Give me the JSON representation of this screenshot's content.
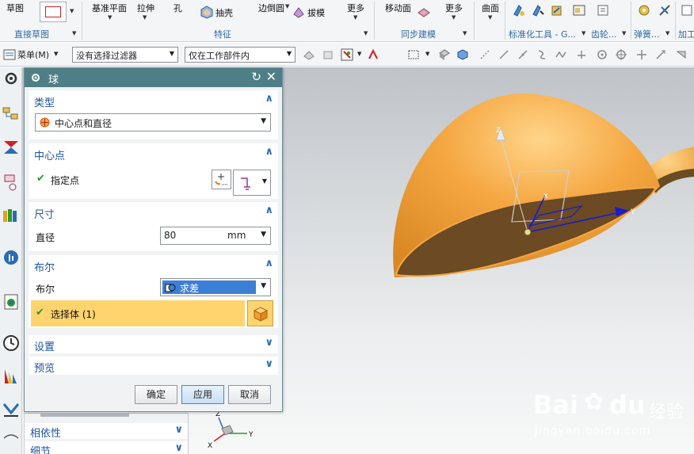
{
  "ribbon": {
    "sketch_label": "草图",
    "datum_plane_label": "基准平面",
    "extrude_label": "拉伸",
    "hole_label": "孔",
    "shell_label": "抽壳",
    "edge_blend_label": "边倒圆",
    "draft_label": "拔模",
    "more_label_1": "更多",
    "move_face_label": "移动面",
    "more_label_2": "更多",
    "surface_label": "曲面",
    "groups": {
      "direct_sketch": "直接草图",
      "feature": "特征",
      "sync_modeling": "同步建模",
      "standard_tools": "标准化工具 - G...",
      "gear": "齿轮...",
      "spring": "弹簧...",
      "machining": "加工"
    }
  },
  "toolbar2": {
    "menu_label": "菜单(M)",
    "filter_value": "没有选择过滤器",
    "scope_value": "仅在工作部件内"
  },
  "dialog": {
    "title": "球",
    "sections": {
      "type": {
        "title": "类型",
        "value": "中心点和直径"
      },
      "center": {
        "title": "中心点",
        "specify_point_label": "指定点"
      },
      "dimension": {
        "title": "尺寸",
        "diameter_label": "直径",
        "diameter_value": "80",
        "unit": "mm"
      },
      "boolean": {
        "title": "布尔",
        "boolean_label": "布尔",
        "boolean_value": "求差",
        "select_body_label": "选择体 (1)"
      },
      "settings": {
        "title": "设置"
      },
      "preview": {
        "title": "预览"
      }
    },
    "buttons": {
      "ok": "确定",
      "apply": "应用",
      "cancel": "取消"
    }
  },
  "lower_panel": {
    "dependency_label": "相依性",
    "details_label": "细节"
  },
  "viewport": {
    "triad_labels": {
      "x": "X",
      "y": "Y",
      "z": "Z"
    },
    "csys_labels": {
      "x": "X",
      "y": "Y",
      "z": "Z"
    }
  },
  "watermark": {
    "brand": "Bai",
    "brand_suffix": "du",
    "brand_cn": "经验",
    "url": "jingyan.baidu.com"
  },
  "colors": {
    "accent": "#2a6bb5",
    "title_bar": "#4f7f86",
    "selection_highlight": "#ffd46e",
    "boolean_selected": "#3d7fd6",
    "sphere": "#f5a742",
    "sphere_inner": "#6b4a24"
  }
}
